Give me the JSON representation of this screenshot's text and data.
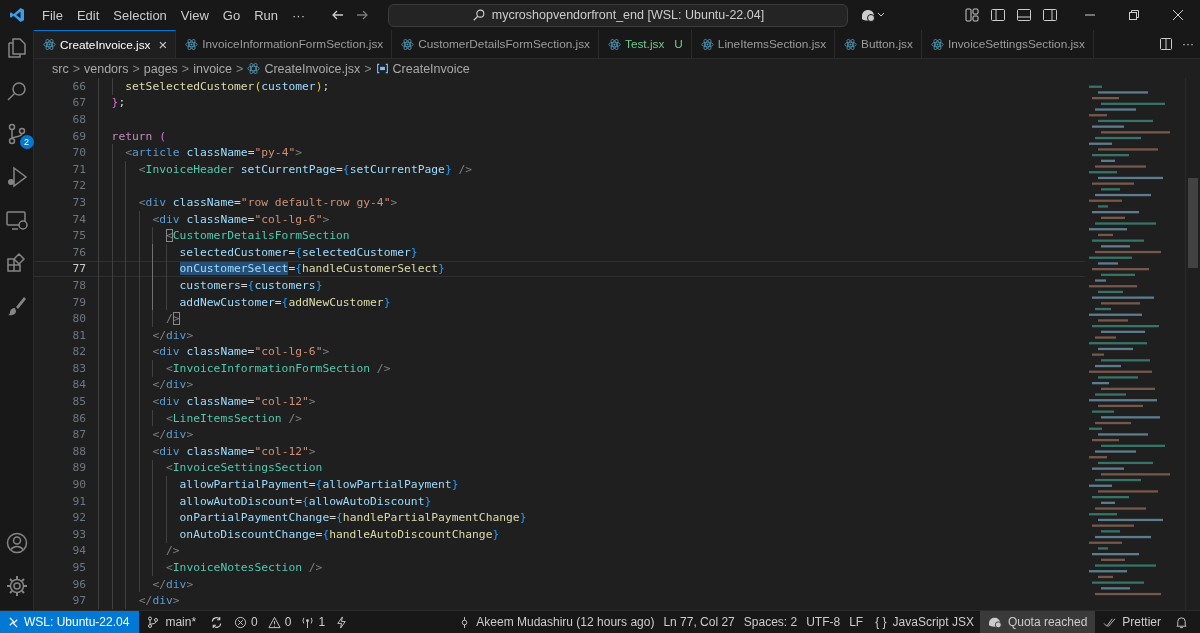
{
  "menu": [
    "File",
    "Edit",
    "Selection",
    "View",
    "Go",
    "Run",
    "···"
  ],
  "command_center": {
    "text": "mycroshopvendorfront_end [WSL: Ubuntu-22.04]"
  },
  "tabs": [
    {
      "label": "CreateInvoice.jsx",
      "selected": true,
      "close": "×"
    },
    {
      "label": "InvoiceInformationFormSection.jsx",
      "selected": false
    },
    {
      "label": "CustomerDetailsFormSection.jsx",
      "selected": false
    },
    {
      "label": "Test.jsx",
      "selected": false,
      "git": "U"
    },
    {
      "label": "LineItemsSection.jsx",
      "selected": false
    },
    {
      "label": "Button.jsx",
      "selected": false
    },
    {
      "label": "InvoiceSettingsSection.jsx",
      "selected": false
    }
  ],
  "tab_more": "···",
  "breadcrumbs": [
    {
      "label": "src",
      "kind": "folder"
    },
    {
      "label": "vendors",
      "kind": "folder"
    },
    {
      "label": "pages",
      "kind": "folder"
    },
    {
      "label": "invoice",
      "kind": "folder"
    },
    {
      "label": "CreateInvoice.jsx",
      "kind": "file"
    },
    {
      "label": "CreateInvoice",
      "kind": "symbol"
    }
  ],
  "breadcrumb_separator": ">",
  "activity_badge": "2",
  "lines": [
    {
      "n": "66",
      "current": false,
      "guides": [
        {
          "active": false
        },
        {
          "active": false
        }
      ],
      "tokens": [
        {
          "kind": "fn",
          "t": "setSelectedCustomer"
        },
        {
          "kind": "p1",
          "t": "("
        },
        {
          "kind": "var",
          "t": "customer"
        },
        {
          "kind": "p1",
          "t": ")"
        },
        {
          "kind": "pl",
          "t": ";"
        }
      ]
    },
    {
      "n": "67",
      "current": false,
      "guides": [
        {
          "active": false
        }
      ],
      "tokens": [
        {
          "kind": "p2",
          "t": "}"
        },
        {
          "kind": "pl",
          "t": ";"
        }
      ]
    },
    {
      "n": "68",
      "current": false,
      "guides": [
        {
          "active": false
        }
      ]
    },
    {
      "n": "69",
      "current": false,
      "guides": [
        {
          "active": false
        }
      ],
      "tokens": [
        {
          "kind": "kw",
          "t": "return"
        },
        {
          "kind": "p2",
          "t": " ("
        }
      ]
    },
    {
      "n": "70",
      "current": false,
      "guides": [
        {
          "active": false
        },
        {
          "active": false
        }
      ],
      "tokens": [
        {
          "kind": "tagp",
          "t": "<"
        },
        {
          "kind": "tag",
          "t": "article"
        },
        {
          "kind": "attr",
          "t": " className"
        },
        {
          "kind": "pl",
          "t": "="
        },
        {
          "kind": "str",
          "t": "\"py-4\""
        },
        {
          "kind": "tagp",
          "t": ">"
        }
      ]
    },
    {
      "n": "71",
      "current": false,
      "guides": [
        {
          "active": false
        },
        {
          "active": false
        },
        {
          "active": false
        }
      ],
      "tokens": [
        {
          "kind": "tagp",
          "t": "<"
        },
        {
          "kind": "comp",
          "t": "InvoiceHeader"
        },
        {
          "kind": "attr",
          "t": " setCurrentPage"
        },
        {
          "kind": "pl",
          "t": "="
        },
        {
          "kind": "p3",
          "t": "{"
        },
        {
          "kind": "var",
          "t": "setCurrentPage"
        },
        {
          "kind": "p3",
          "t": "}"
        },
        {
          "kind": "tagp",
          "t": " />"
        }
      ]
    },
    {
      "n": "72",
      "current": false,
      "guides": [
        {
          "active": false
        },
        {
          "active": false
        },
        {
          "active": false
        }
      ]
    },
    {
      "n": "73",
      "current": false,
      "guides": [
        {
          "active": false
        },
        {
          "active": false
        },
        {
          "active": false
        }
      ],
      "tokens": [
        {
          "kind": "tagp",
          "t": "<"
        },
        {
          "kind": "tag",
          "t": "div"
        },
        {
          "kind": "attr",
          "t": " className"
        },
        {
          "kind": "pl",
          "t": "="
        },
        {
          "kind": "str",
          "t": "\"row default-row gy-4\""
        },
        {
          "kind": "tagp",
          "t": ">"
        }
      ]
    },
    {
      "n": "74",
      "current": false,
      "guides": [
        {
          "active": false
        },
        {
          "active": false
        },
        {
          "active": false
        },
        {
          "active": false
        }
      ],
      "tokens": [
        {
          "kind": "tagp",
          "t": "<"
        },
        {
          "kind": "tag",
          "t": "div"
        },
        {
          "kind": "attr",
          "t": " className"
        },
        {
          "kind": "pl",
          "t": "="
        },
        {
          "kind": "str",
          "t": "\"col-lg-6\""
        },
        {
          "kind": "tagp",
          "t": ">"
        }
      ]
    },
    {
      "n": "75",
      "current": false,
      "guides": [
        {
          "active": false
        },
        {
          "active": false
        },
        {
          "active": false
        },
        {
          "active": false
        },
        {
          "active": false
        }
      ],
      "tokens": [
        {
          "kind": "match",
          "t": "<"
        },
        {
          "kind": "comp",
          "t": "CustomerDetailsFormSection"
        }
      ]
    },
    {
      "n": "76",
      "current": false,
      "guides": [
        {
          "active": false
        },
        {
          "active": false
        },
        {
          "active": false
        },
        {
          "active": false
        },
        {
          "active": true
        },
        {
          "active": false
        }
      ],
      "tokens": [
        {
          "kind": "attr",
          "t": "selectedCustomer"
        },
        {
          "kind": "pl",
          "t": "="
        },
        {
          "kind": "p3",
          "t": "{"
        },
        {
          "kind": "var",
          "t": "selectedCustomer"
        },
        {
          "kind": "p3",
          "t": "}"
        }
      ]
    },
    {
      "n": "77",
      "current": true,
      "guides": [
        {
          "active": false
        },
        {
          "active": false
        },
        {
          "active": false
        },
        {
          "active": false
        },
        {
          "active": true
        },
        {
          "active": false
        }
      ],
      "tokens": [
        {
          "kind": "sel",
          "t": "onCustomerSelect"
        },
        {
          "kind": "pl",
          "t": "="
        },
        {
          "kind": "p3",
          "t": "{"
        },
        {
          "kind": "fn",
          "t": "handleCustomerSelect"
        },
        {
          "kind": "p3",
          "t": "}"
        }
      ]
    },
    {
      "n": "78",
      "current": false,
      "guides": [
        {
          "active": false
        },
        {
          "active": false
        },
        {
          "active": false
        },
        {
          "active": false
        },
        {
          "active": true
        },
        {
          "active": false
        }
      ],
      "tokens": [
        {
          "kind": "attr",
          "t": "customers"
        },
        {
          "kind": "pl",
          "t": "="
        },
        {
          "kind": "p3",
          "t": "{"
        },
        {
          "kind": "var",
          "t": "customers"
        },
        {
          "kind": "p3",
          "t": "}"
        }
      ]
    },
    {
      "n": "79",
      "current": false,
      "guides": [
        {
          "active": false
        },
        {
          "active": false
        },
        {
          "active": false
        },
        {
          "active": false
        },
        {
          "active": true
        },
        {
          "active": false
        }
      ],
      "tokens": [
        {
          "kind": "attr",
          "t": "addNewCustomer"
        },
        {
          "kind": "pl",
          "t": "="
        },
        {
          "kind": "p3",
          "t": "{"
        },
        {
          "kind": "fn",
          "t": "addNewCustomer"
        },
        {
          "kind": "p3",
          "t": "}"
        }
      ]
    },
    {
      "n": "80",
      "current": false,
      "guides": [
        {
          "active": false
        },
        {
          "active": false
        },
        {
          "active": false
        },
        {
          "active": false
        },
        {
          "active": false
        }
      ],
      "tokens": [
        {
          "kind": "tagp",
          "t": "/"
        },
        {
          "kind": "match",
          "t": ">"
        }
      ]
    },
    {
      "n": "81",
      "current": false,
      "guides": [
        {
          "active": false
        },
        {
          "active": false
        },
        {
          "active": false
        },
        {
          "active": false
        }
      ],
      "tokens": [
        {
          "kind": "tagp",
          "t": "</"
        },
        {
          "kind": "tag",
          "t": "div"
        },
        {
          "kind": "tagp",
          "t": ">"
        }
      ]
    },
    {
      "n": "82",
      "current": false,
      "guides": [
        {
          "active": false
        },
        {
          "active": false
        },
        {
          "active": false
        },
        {
          "active": false
        }
      ],
      "tokens": [
        {
          "kind": "tagp",
          "t": "<"
        },
        {
          "kind": "tag",
          "t": "div"
        },
        {
          "kind": "attr",
          "t": " className"
        },
        {
          "kind": "pl",
          "t": "="
        },
        {
          "kind": "str",
          "t": "\"col-lg-6\""
        },
        {
          "kind": "tagp",
          "t": ">"
        }
      ]
    },
    {
      "n": "83",
      "current": false,
      "guides": [
        {
          "active": false
        },
        {
          "active": false
        },
        {
          "active": false
        },
        {
          "active": false
        },
        {
          "active": false
        }
      ],
      "tokens": [
        {
          "kind": "tagp",
          "t": "<"
        },
        {
          "kind": "comp",
          "t": "InvoiceInformationFormSection"
        },
        {
          "kind": "tagp",
          "t": " />"
        }
      ]
    },
    {
      "n": "84",
      "current": false,
      "guides": [
        {
          "active": false
        },
        {
          "active": false
        },
        {
          "active": false
        },
        {
          "active": false
        }
      ],
      "tokens": [
        {
          "kind": "tagp",
          "t": "</"
        },
        {
          "kind": "tag",
          "t": "div"
        },
        {
          "kind": "tagp",
          "t": ">"
        }
      ]
    },
    {
      "n": "85",
      "current": false,
      "guides": [
        {
          "active": false
        },
        {
          "active": false
        },
        {
          "active": false
        },
        {
          "active": false
        }
      ],
      "tokens": [
        {
          "kind": "tagp",
          "t": "<"
        },
        {
          "kind": "tag",
          "t": "div"
        },
        {
          "kind": "attr",
          "t": " className"
        },
        {
          "kind": "pl",
          "t": "="
        },
        {
          "kind": "str",
          "t": "\"col-12\""
        },
        {
          "kind": "tagp",
          "t": ">"
        }
      ]
    },
    {
      "n": "86",
      "current": false,
      "guides": [
        {
          "active": false
        },
        {
          "active": false
        },
        {
          "active": false
        },
        {
          "active": false
        },
        {
          "active": false
        }
      ],
      "tokens": [
        {
          "kind": "tagp",
          "t": "<"
        },
        {
          "kind": "comp",
          "t": "LineItemsSection"
        },
        {
          "kind": "tagp",
          "t": " />"
        }
      ]
    },
    {
      "n": "87",
      "current": false,
      "guides": [
        {
          "active": false
        },
        {
          "active": false
        },
        {
          "active": false
        },
        {
          "active": false
        }
      ],
      "tokens": [
        {
          "kind": "tagp",
          "t": "</"
        },
        {
          "kind": "tag",
          "t": "div"
        },
        {
          "kind": "tagp",
          "t": ">"
        }
      ]
    },
    {
      "n": "88",
      "current": false,
      "guides": [
        {
          "active": false
        },
        {
          "active": false
        },
        {
          "active": false
        },
        {
          "active": false
        }
      ],
      "tokens": [
        {
          "kind": "tagp",
          "t": "<"
        },
        {
          "kind": "tag",
          "t": "div"
        },
        {
          "kind": "attr",
          "t": " className"
        },
        {
          "kind": "pl",
          "t": "="
        },
        {
          "kind": "str",
          "t": "\"col-12\""
        },
        {
          "kind": "tagp",
          "t": ">"
        }
      ]
    },
    {
      "n": "89",
      "current": false,
      "guides": [
        {
          "active": false
        },
        {
          "active": false
        },
        {
          "active": false
        },
        {
          "active": false
        },
        {
          "active": false
        }
      ],
      "tokens": [
        {
          "kind": "tagp",
          "t": "<"
        },
        {
          "kind": "comp",
          "t": "InvoiceSettingsSection"
        }
      ]
    },
    {
      "n": "90",
      "current": false,
      "guides": [
        {
          "active": false
        },
        {
          "active": false
        },
        {
          "active": false
        },
        {
          "active": false
        },
        {
          "active": false
        },
        {
          "active": false
        }
      ],
      "tokens": [
        {
          "kind": "attr",
          "t": "allowPartialPayment"
        },
        {
          "kind": "pl",
          "t": "="
        },
        {
          "kind": "p3",
          "t": "{"
        },
        {
          "kind": "var",
          "t": "allowPartialPayment"
        },
        {
          "kind": "p3",
          "t": "}"
        }
      ]
    },
    {
      "n": "91",
      "current": false,
      "guides": [
        {
          "active": false
        },
        {
          "active": false
        },
        {
          "active": false
        },
        {
          "active": false
        },
        {
          "active": false
        },
        {
          "active": false
        }
      ],
      "tokens": [
        {
          "kind": "attr",
          "t": "allowAutoDiscount"
        },
        {
          "kind": "pl",
          "t": "="
        },
        {
          "kind": "p3",
          "t": "{"
        },
        {
          "kind": "var",
          "t": "allowAutoDiscount"
        },
        {
          "kind": "p3",
          "t": "}"
        }
      ]
    },
    {
      "n": "92",
      "current": false,
      "guides": [
        {
          "active": false
        },
        {
          "active": false
        },
        {
          "active": false
        },
        {
          "active": false
        },
        {
          "active": false
        },
        {
          "active": false
        }
      ],
      "tokens": [
        {
          "kind": "attr",
          "t": "onPartialPaymentChange"
        },
        {
          "kind": "pl",
          "t": "="
        },
        {
          "kind": "p3",
          "t": "{"
        },
        {
          "kind": "fn",
          "t": "handlePartialPaymentChange"
        },
        {
          "kind": "p3",
          "t": "}"
        }
      ]
    },
    {
      "n": "93",
      "current": false,
      "guides": [
        {
          "active": false
        },
        {
          "active": false
        },
        {
          "active": false
        },
        {
          "active": false
        },
        {
          "active": false
        },
        {
          "active": false
        }
      ],
      "tokens": [
        {
          "kind": "attr",
          "t": "onAutoDiscountChange"
        },
        {
          "kind": "pl",
          "t": "="
        },
        {
          "kind": "p3",
          "t": "{"
        },
        {
          "kind": "fn",
          "t": "handleAutoDiscountChange"
        },
        {
          "kind": "p3",
          "t": "}"
        }
      ]
    },
    {
      "n": "94",
      "current": false,
      "guides": [
        {
          "active": false
        },
        {
          "active": false
        },
        {
          "active": false
        },
        {
          "active": false
        },
        {
          "active": false
        }
      ],
      "tokens": [
        {
          "kind": "tagp",
          "t": "/>"
        }
      ]
    },
    {
      "n": "95",
      "current": false,
      "guides": [
        {
          "active": false
        },
        {
          "active": false
        },
        {
          "active": false
        },
        {
          "active": false
        },
        {
          "active": false
        }
      ],
      "tokens": [
        {
          "kind": "tagp",
          "t": "<"
        },
        {
          "kind": "comp",
          "t": "InvoiceNotesSection"
        },
        {
          "kind": "tagp",
          "t": " />"
        }
      ]
    },
    {
      "n": "96",
      "current": false,
      "guides": [
        {
          "active": false
        },
        {
          "active": false
        },
        {
          "active": false
        },
        {
          "active": false
        }
      ],
      "tokens": [
        {
          "kind": "tagp",
          "t": "</"
        },
        {
          "kind": "tag",
          "t": "div"
        },
        {
          "kind": "tagp",
          "t": ">"
        }
      ]
    },
    {
      "n": "97",
      "current": false,
      "guides": [
        {
          "active": false
        },
        {
          "active": false
        },
        {
          "active": false
        }
      ],
      "tokens": [
        {
          "kind": "tagp",
          "t": "</"
        },
        {
          "kind": "tag",
          "t": "div"
        },
        {
          "kind": "tagp",
          "t": ">"
        }
      ]
    }
  ],
  "status_bar": {
    "remote": "WSL: Ubuntu-22.04",
    "branch": "main*",
    "errors": "0",
    "warnings": "0",
    "ports": "1",
    "blame": "Akeem Mudashiru (12 hours ago)",
    "position": "Ln 77, Col 27",
    "indent": "Spaces: 2",
    "encoding": "UTF-8",
    "eol": "LF",
    "language_icon": "{ }",
    "language": "JavaScript JSX",
    "quota": "Quota reached",
    "formatter": "Prettier"
  }
}
